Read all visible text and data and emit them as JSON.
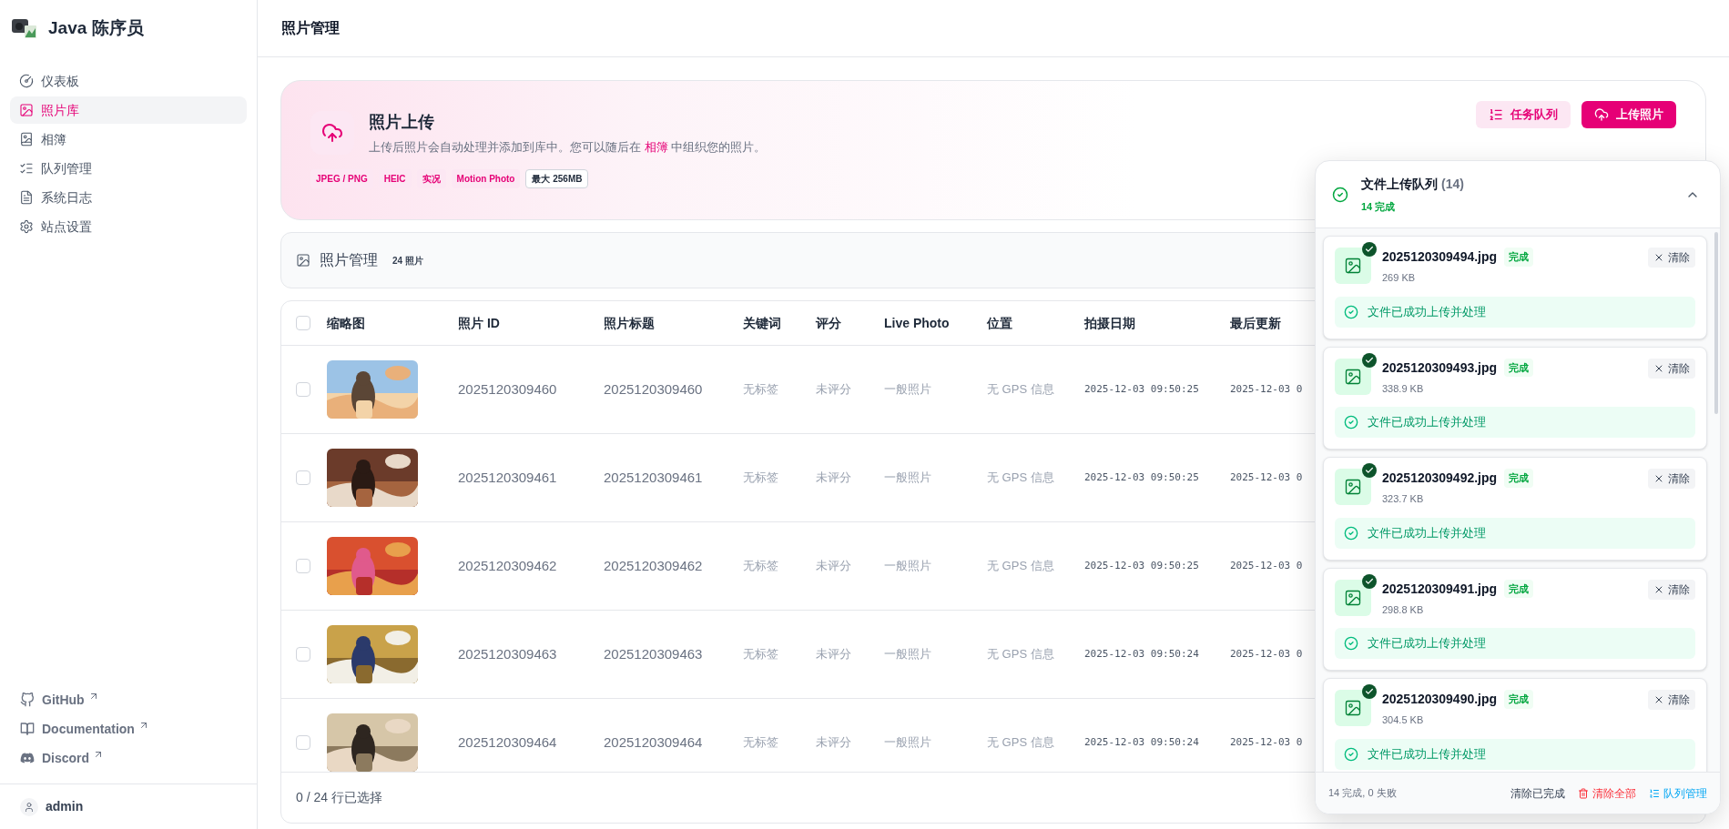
{
  "brand": {
    "name": "Java 陈序员"
  },
  "sidebar": {
    "items": [
      {
        "label": "仪表板",
        "selected": false
      },
      {
        "label": "照片库",
        "selected": true
      },
      {
        "label": "相簿",
        "selected": false
      },
      {
        "label": "队列管理",
        "selected": false
      },
      {
        "label": "系统日志",
        "selected": false
      },
      {
        "label": "站点设置",
        "selected": false
      }
    ],
    "links": [
      {
        "label": "GitHub"
      },
      {
        "label": "Documentation"
      },
      {
        "label": "Discord"
      }
    ],
    "user": "admin"
  },
  "header": {
    "title": "照片管理"
  },
  "upload_card": {
    "title": "照片上传",
    "description": "上传后照片会自动处理并添加到库中。您可以随后在 ",
    "description_link": "相簿",
    "description_end": " 中组织您的照片。",
    "tags": [
      "JPEG / PNG",
      "HEIC",
      "实况",
      "Motion Photo"
    ],
    "size_tag": "最大 256MB",
    "buttons": [
      {
        "label": "任务队列",
        "kind": "secondary"
      },
      {
        "label": "上传照片",
        "kind": "primary"
      }
    ]
  },
  "photos_bar": {
    "title": "照片管理",
    "count": "24 照片"
  },
  "table": {
    "select_all_checked": false,
    "columns": [
      "缩略图",
      "照片 ID",
      "照片标题",
      "关键词",
      "评分",
      "Live Photo",
      "位置",
      "拍摄日期",
      "最后更新"
    ],
    "rows": [
      {
        "checked": false,
        "photo_id": "2025120309460",
        "title": "2025120309460",
        "keywords": "无标签",
        "rating": "未评分",
        "live_photo": "一般照片",
        "location": "无 GPS 信息",
        "taken": "2025-12-03 09:50:25",
        "updated": "2025-12-03 0"
      },
      {
        "checked": false,
        "photo_id": "2025120309461",
        "title": "2025120309461",
        "keywords": "无标签",
        "rating": "未评分",
        "live_photo": "一般照片",
        "location": "无 GPS 信息",
        "taken": "2025-12-03 09:50:25",
        "updated": "2025-12-03 0"
      },
      {
        "checked": false,
        "photo_id": "2025120309462",
        "title": "2025120309462",
        "keywords": "无标签",
        "rating": "未评分",
        "live_photo": "一般照片",
        "location": "无 GPS 信息",
        "taken": "2025-12-03 09:50:25",
        "updated": "2025-12-03 0"
      },
      {
        "checked": false,
        "photo_id": "2025120309463",
        "title": "2025120309463",
        "keywords": "无标签",
        "rating": "未评分",
        "live_photo": "一般照片",
        "location": "无 GPS 信息",
        "taken": "2025-12-03 09:50:24",
        "updated": "2025-12-03 0"
      },
      {
        "checked": false,
        "photo_id": "2025120309464",
        "title": "2025120309464",
        "keywords": "无标签",
        "rating": "未评分",
        "live_photo": "一般照片",
        "location": "无 GPS 信息",
        "taken": "2025-12-03 09:50:24",
        "updated": "2025-12-03 0"
      }
    ],
    "footer": "0 / 24 行已选择"
  },
  "queue": {
    "title": "文件上传队列",
    "count": "(14)",
    "summary": "14 完成",
    "expanded": true,
    "items": [
      {
        "name": "2025120309494.jpg",
        "status": "完成",
        "done": true,
        "size": "269 KB",
        "clear": "清除",
        "message": "文件已成功上传并处理"
      },
      {
        "name": "2025120309493.jpg",
        "status": "完成",
        "done": true,
        "size": "338.9 KB",
        "clear": "清除",
        "message": "文件已成功上传并处理"
      },
      {
        "name": "2025120309492.jpg",
        "status": "完成",
        "done": true,
        "size": "323.7 KB",
        "clear": "清除",
        "message": "文件已成功上传并处理"
      },
      {
        "name": "2025120309491.jpg",
        "status": "完成",
        "done": true,
        "size": "298.8 KB",
        "clear": "清除",
        "message": "文件已成功上传并处理"
      },
      {
        "name": "2025120309490.jpg",
        "status": "完成",
        "done": true,
        "size": "304.5 KB",
        "clear": "清除",
        "message": "文件已成功上传并处理"
      }
    ],
    "footer": {
      "stats": "14 完成, 0 失败",
      "actions": [
        {
          "label": "清除已完成",
          "kind": "plain"
        },
        {
          "label": "清除全部",
          "kind": "danger"
        },
        {
          "label": "队列管理",
          "kind": "link"
        }
      ]
    }
  }
}
